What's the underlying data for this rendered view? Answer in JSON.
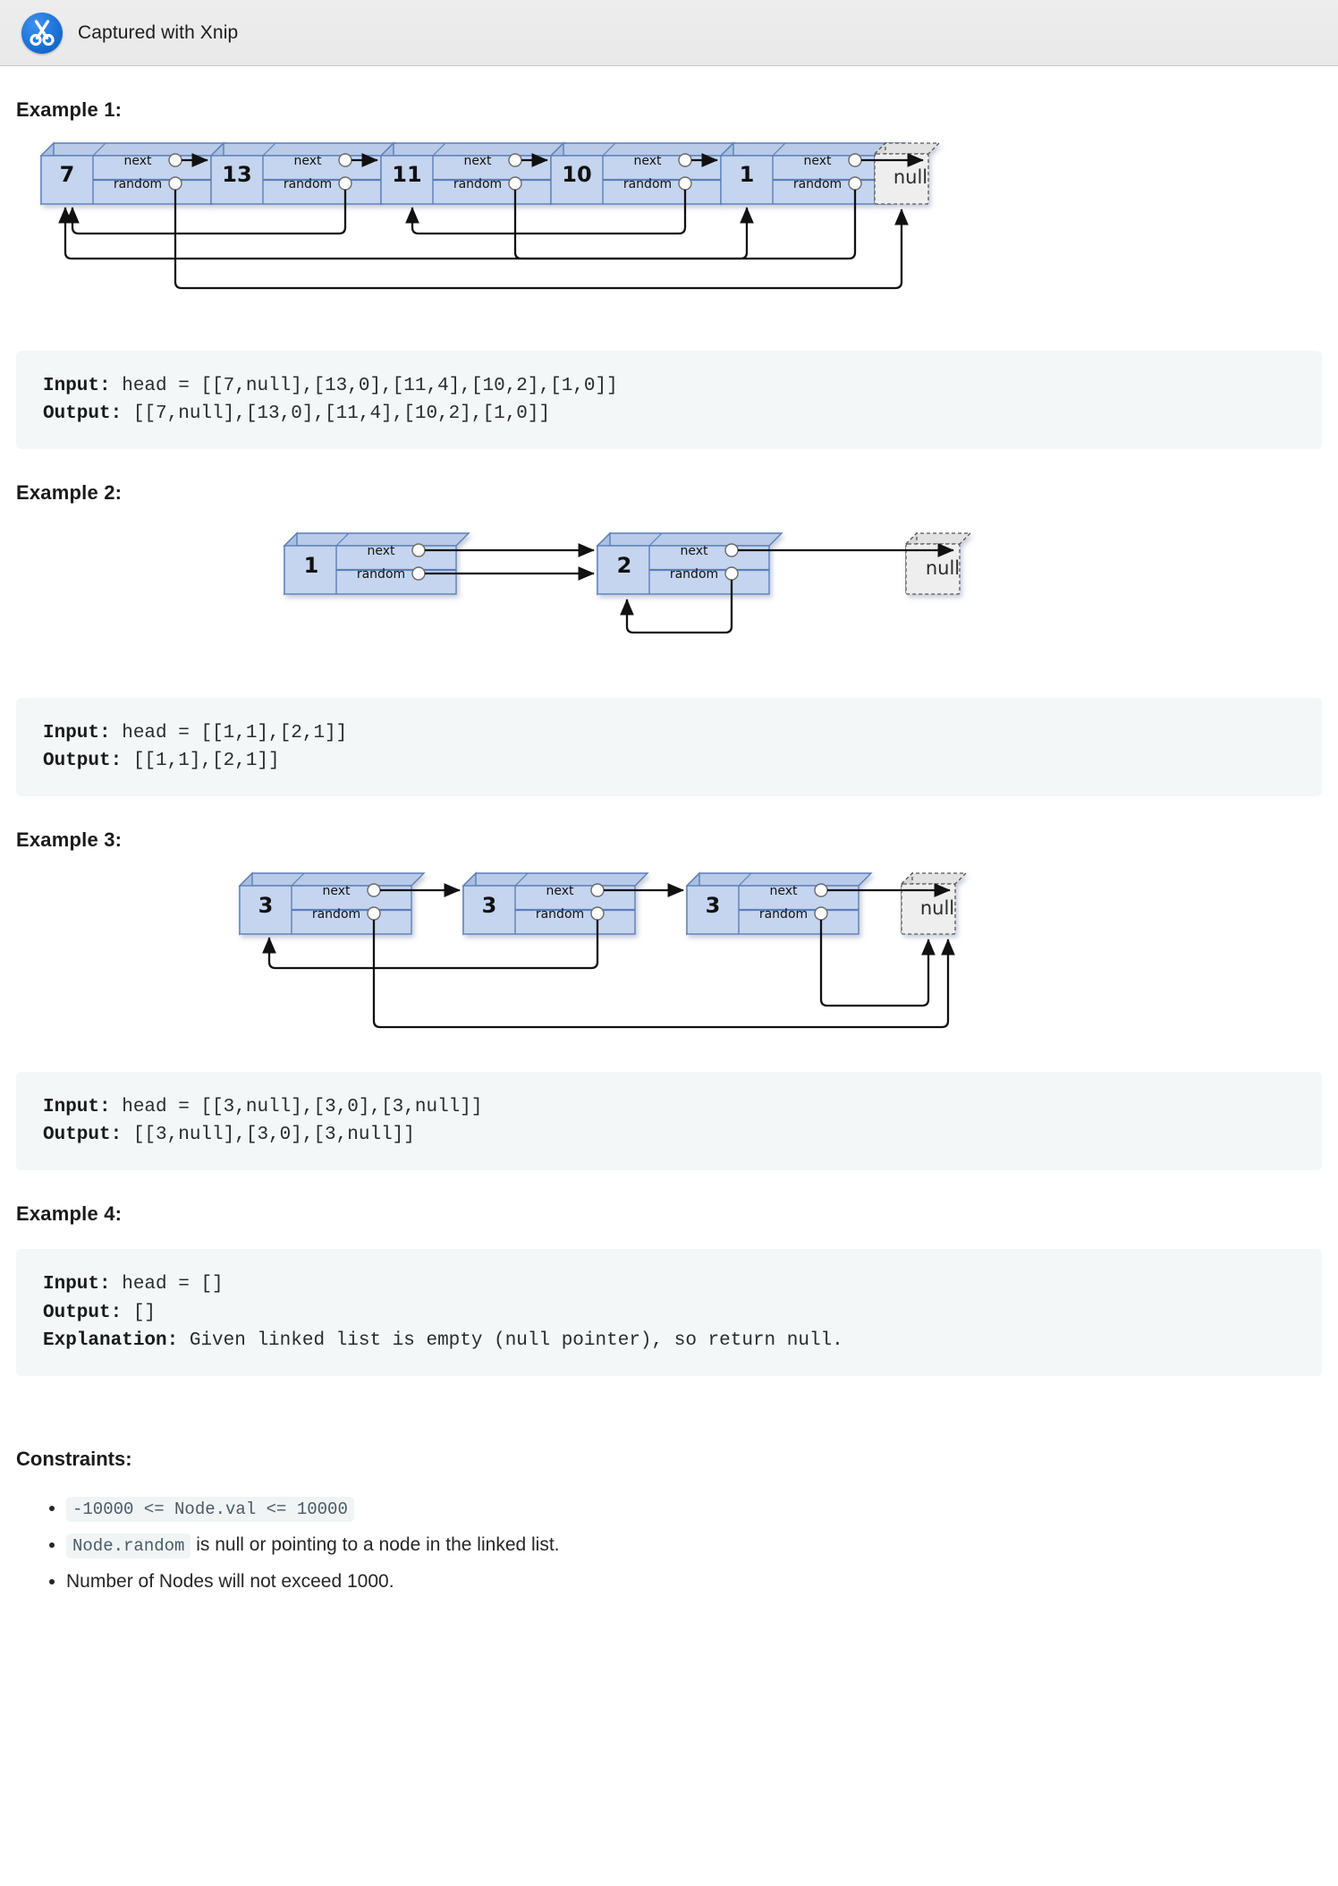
{
  "header": {
    "title": "Captured with Xnip",
    "logo_icon": "scissors-icon"
  },
  "examples": [
    {
      "heading": "Example 1:",
      "input_label": "Input:",
      "input_value": " head = [[7,null],[13,0],[11,4],[10,2],[1,0]]",
      "output_label": "Output:",
      "output_value": " [[7,null],[13,0],[11,4],[10,2],[1,0]]"
    },
    {
      "heading": "Example 2:",
      "input_label": "Input:",
      "input_value": " head = [[1,1],[2,1]]",
      "output_label": "Output:",
      "output_value": " [[1,1],[2,1]]"
    },
    {
      "heading": "Example 3:",
      "input_label": "Input:",
      "input_value": " head = [[3,null],[3,0],[3,null]]",
      "output_label": "Output:",
      "output_value": " [[3,null],[3,0],[3,null]]"
    },
    {
      "heading": "Example 4:",
      "input_label": "Input:",
      "input_value": " head = []",
      "output_label": "Output:",
      "output_value": " []",
      "explanation_label": "Explanation:",
      "explanation_value": " Given linked list is empty (null pointer), so return null."
    }
  ],
  "constraints": {
    "heading": "Constraints:",
    "items": [
      {
        "code": "-10000 <= Node.val <= 10000",
        "text": ""
      },
      {
        "code": "Node.random",
        "text": " is null or pointing to a node in the linked list."
      },
      {
        "code": "",
        "text": "Number of Nodes will not exceed 1000."
      }
    ]
  },
  "node_labels": {
    "next": "next",
    "random": "random",
    "null": "null"
  },
  "diagrams": {
    "example1": {
      "values": [
        "7",
        "13",
        "11",
        "10",
        "1"
      ],
      "random_targets": [
        "null",
        "0",
        "4",
        "2",
        "0"
      ]
    },
    "example2": {
      "values": [
        "1",
        "2"
      ],
      "random_targets": [
        "1",
        "1"
      ]
    },
    "example3": {
      "values": [
        "3",
        "3",
        "3"
      ],
      "random_targets": [
        "null",
        "0",
        "null"
      ]
    }
  },
  "colors": {
    "node_fill": "#c5d5ef",
    "node_stroke": "#5b7fb8",
    "node_top": "#b9cbe8",
    "node_side": "#aabfe0",
    "null_fill": "#eeeeee",
    "null_stroke": "#555555",
    "code_bg": "#f3f7f8",
    "header_bg": "#ededed"
  }
}
